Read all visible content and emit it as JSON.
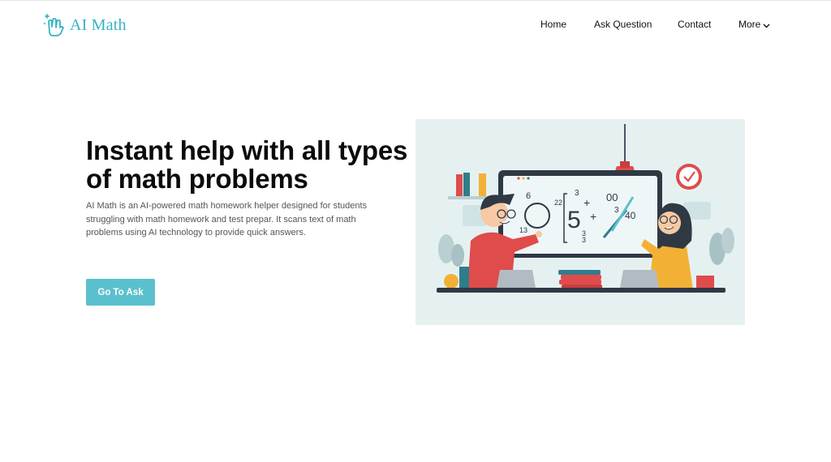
{
  "brand": {
    "name": "AI Math",
    "color": "#35b4c3",
    "icon": "hand-sparkle-icon"
  },
  "nav": {
    "items": [
      "Home",
      "Ask Question",
      "Contact",
      "More"
    ],
    "more_icon": "chevron-down-icon"
  },
  "hero": {
    "title": "Instant help with all types of math problems",
    "description": "AI Math is an AI-powered math homework helper designed for students struggling with math homework and test prepar. It scans text of math problems using AI technology to provide quick answers.",
    "cta_label": "Go To Ask",
    "cta_color": "#5bc0cd"
  },
  "illustration": {
    "board_numerals": [
      "3",
      "00",
      "+",
      "5",
      "+",
      "3",
      "40",
      "3",
      "3",
      "6",
      "22",
      "13"
    ]
  }
}
